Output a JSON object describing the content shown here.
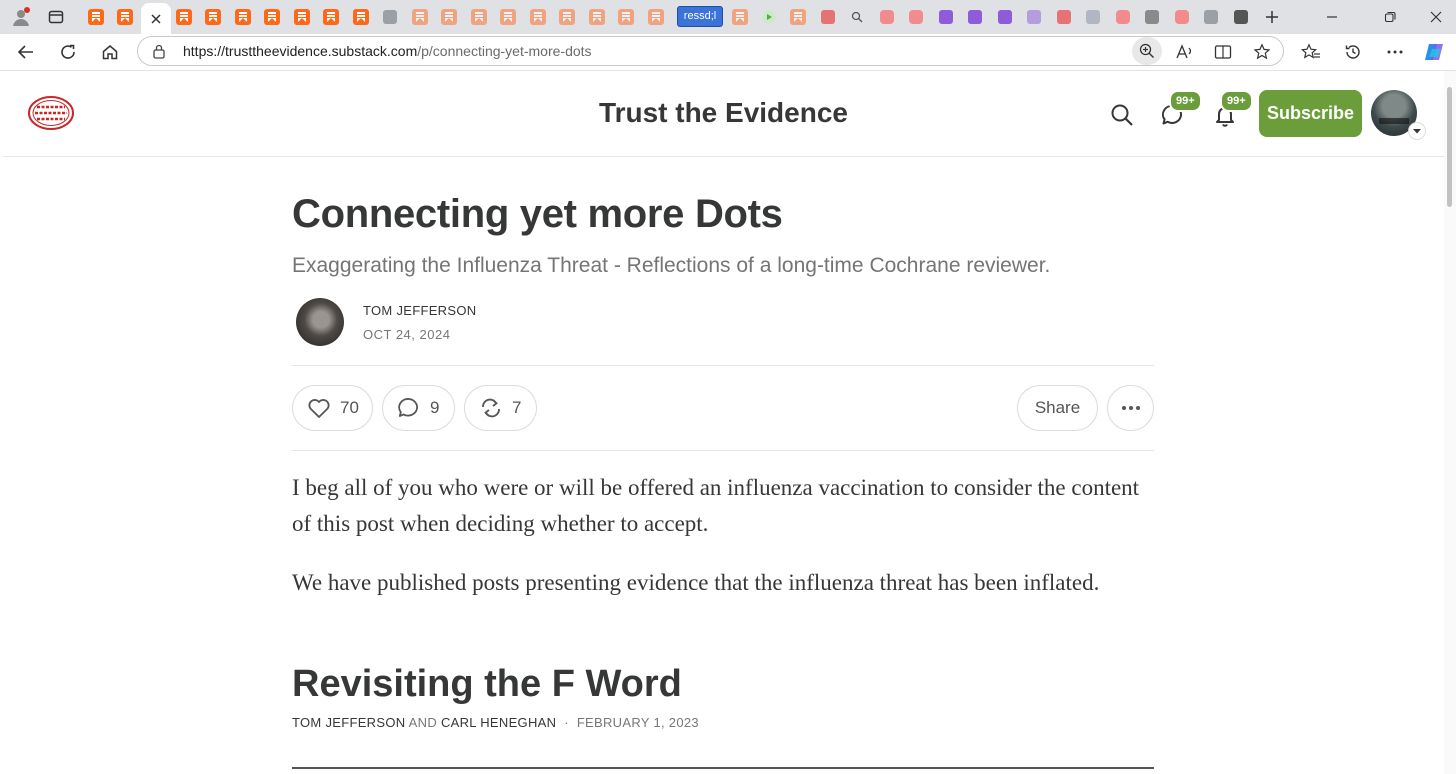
{
  "browser": {
    "rss_tab_label": "ressd;l",
    "url_host": "https://trusttheevidence.substack.com",
    "url_path": "/p/connecting-yet-more-dots"
  },
  "site": {
    "title": "Trust the Evidence",
    "chat_badge": "99+",
    "notifications_badge": "99+",
    "subscribe_label": "Subscribe"
  },
  "post": {
    "title": "Connecting yet more Dots",
    "subtitle": "Exaggerating the Influenza Threat - Reflections of a long-time Cochrane reviewer.",
    "author": "TOM JEFFERSON",
    "date": "OCT 24, 2024",
    "likes": "70",
    "comments": "9",
    "restacks": "7",
    "share_label": "Share",
    "paragraphs": [
      "I beg all of you who were or will be offered an influenza vaccination to consider the content of this post when deciding whether to accept.",
      "We have published posts presenting evidence that the influenza threat has been inflated."
    ]
  },
  "embedded": {
    "title": "Revisiting the F Word",
    "author1": "TOM JEFFERSON",
    "and_word": "AND",
    "author2": "CARL HENEGHAN",
    "separator": "·",
    "date": "FEBRUARY 1, 2023"
  },
  "colors": {
    "accent_green": "#6b9d3a",
    "substack_orange": "#ff6719",
    "text_dark": "#363737"
  }
}
